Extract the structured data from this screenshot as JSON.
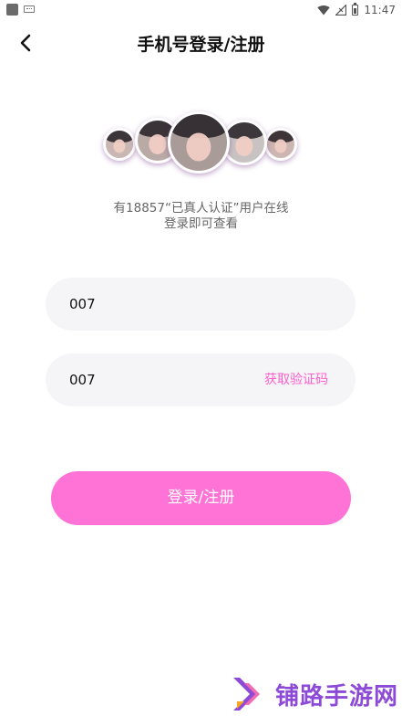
{
  "status_bar": {
    "time": "11:47",
    "icons": [
      "app-icon",
      "keyboard-icon",
      "wifi-icon",
      "signal-icon",
      "battery-icon"
    ]
  },
  "header": {
    "title": "手机号登录/注册",
    "back_icon": "chevron-left-icon"
  },
  "promo": {
    "line1": "有18857“已真人认证”用户在线",
    "line2": "登录即可查看"
  },
  "form": {
    "phone_value": "007",
    "code_value": "007",
    "get_code_label": "获取验证码"
  },
  "login_button": {
    "label": "登录/注册"
  },
  "watermark": {
    "text": "铺路手游网"
  },
  "colors": {
    "accent": "#ff73d6",
    "link": "#ff5fce",
    "field_bg": "#f5f5f7",
    "watermark": "#8c4ad6"
  }
}
